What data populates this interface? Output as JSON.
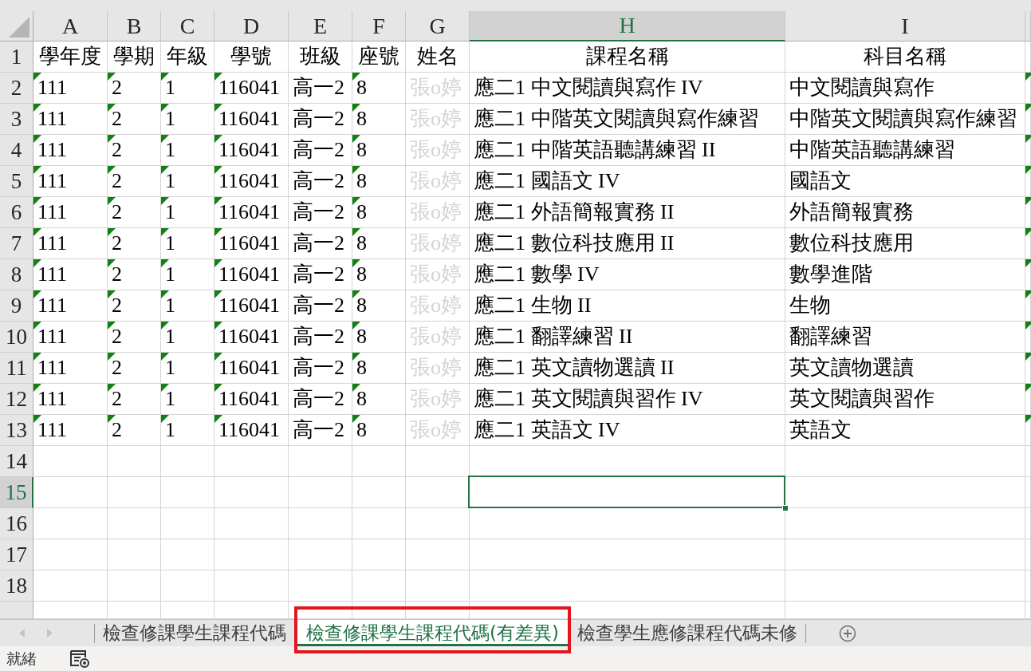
{
  "columns": [
    {
      "letter": "A",
      "selected": false,
      "flagged": true,
      "faded": false
    },
    {
      "letter": "B",
      "selected": false,
      "flagged": true,
      "faded": false
    },
    {
      "letter": "C",
      "selected": false,
      "flagged": true,
      "faded": false
    },
    {
      "letter": "D",
      "selected": false,
      "flagged": true,
      "faded": false
    },
    {
      "letter": "E",
      "selected": false,
      "flagged": false,
      "faded": false
    },
    {
      "letter": "F",
      "selected": false,
      "flagged": true,
      "faded": false
    },
    {
      "letter": "G",
      "selected": false,
      "flagged": false,
      "faded": true
    },
    {
      "letter": "H",
      "selected": true,
      "flagged": false,
      "faded": false
    },
    {
      "letter": "I",
      "selected": false,
      "flagged": false,
      "faded": false
    },
    {
      "selected": false,
      "flagged": true,
      "faded": false
    }
  ],
  "header_row": {
    "number": "1",
    "selected": false,
    "cells": [
      "學年度",
      "學期",
      "年級",
      "學號",
      "班級",
      "座號",
      "姓名",
      "課程名稱",
      "科目名稱"
    ]
  },
  "rows": [
    {
      "number": "2",
      "selected": false,
      "cells": [
        "111",
        "2",
        "1",
        "116041",
        "高一2",
        "8",
        "張o婷",
        "應二1 中文閱讀與寫作 IV",
        "中文閱讀與寫作"
      ]
    },
    {
      "number": "3",
      "selected": false,
      "cells": [
        "111",
        "2",
        "1",
        "116041",
        "高一2",
        "8",
        "張o婷",
        "應二1 中階英文閱讀與寫作練習",
        "中階英文閱讀與寫作練習"
      ]
    },
    {
      "number": "4",
      "selected": false,
      "cells": [
        "111",
        "2",
        "1",
        "116041",
        "高一2",
        "8",
        "張o婷",
        "應二1 中階英語聽講練習 II",
        "中階英語聽講練習"
      ]
    },
    {
      "number": "5",
      "selected": false,
      "cells": [
        "111",
        "2",
        "1",
        "116041",
        "高一2",
        "8",
        "張o婷",
        "應二1 國語文 IV",
        "國語文"
      ]
    },
    {
      "number": "6",
      "selected": false,
      "cells": [
        "111",
        "2",
        "1",
        "116041",
        "高一2",
        "8",
        "張o婷",
        "應二1 外語簡報實務 II",
        "外語簡報實務"
      ]
    },
    {
      "number": "7",
      "selected": false,
      "cells": [
        "111",
        "2",
        "1",
        "116041",
        "高一2",
        "8",
        "張o婷",
        "應二1 數位科技應用 II",
        "數位科技應用"
      ]
    },
    {
      "number": "8",
      "selected": false,
      "cells": [
        "111",
        "2",
        "1",
        "116041",
        "高一2",
        "8",
        "張o婷",
        "應二1 數學 IV",
        "數學進階"
      ]
    },
    {
      "number": "9",
      "selected": false,
      "cells": [
        "111",
        "2",
        "1",
        "116041",
        "高一2",
        "8",
        "張o婷",
        "應二1 生物 II",
        "生物"
      ]
    },
    {
      "number": "10",
      "selected": false,
      "cells": [
        "111",
        "2",
        "1",
        "116041",
        "高一2",
        "8",
        "張o婷",
        "應二1 翻譯練習 II",
        "翻譯練習"
      ]
    },
    {
      "number": "11",
      "selected": false,
      "cells": [
        "111",
        "2",
        "1",
        "116041",
        "高一2",
        "8",
        "張o婷",
        "應二1 英文讀物選讀 II",
        "英文讀物選讀"
      ]
    },
    {
      "number": "12",
      "selected": false,
      "cells": [
        "111",
        "2",
        "1",
        "116041",
        "高一2",
        "8",
        "張o婷",
        "應二1 英文閱讀與習作 IV",
        "英文閱讀與習作"
      ]
    },
    {
      "number": "13",
      "selected": false,
      "cells": [
        "111",
        "2",
        "1",
        "116041",
        "高一2",
        "8",
        "張o婷",
        "應二1 英語文 IV",
        "英語文"
      ]
    },
    {
      "number": "14",
      "selected": false,
      "cells": []
    },
    {
      "number": "15",
      "selected": true,
      "cells": []
    },
    {
      "number": "16",
      "selected": false,
      "cells": []
    },
    {
      "number": "17",
      "selected": false,
      "cells": []
    },
    {
      "number": "18",
      "selected": false,
      "cells": []
    }
  ],
  "tab_scroll": {
    "disabled": true
  },
  "sheet_tabs": [
    {
      "label": "檢查修課學生課程代碼",
      "selected": false,
      "highlighted": false
    },
    {
      "label": "檢查修課學生課程代碼(有差異)",
      "selected": true,
      "highlighted": true
    },
    {
      "label": "檢查學生應修課程代碼未修",
      "selected": false,
      "highlighted": false
    }
  ],
  "status_bar": {
    "text": "就緒"
  }
}
